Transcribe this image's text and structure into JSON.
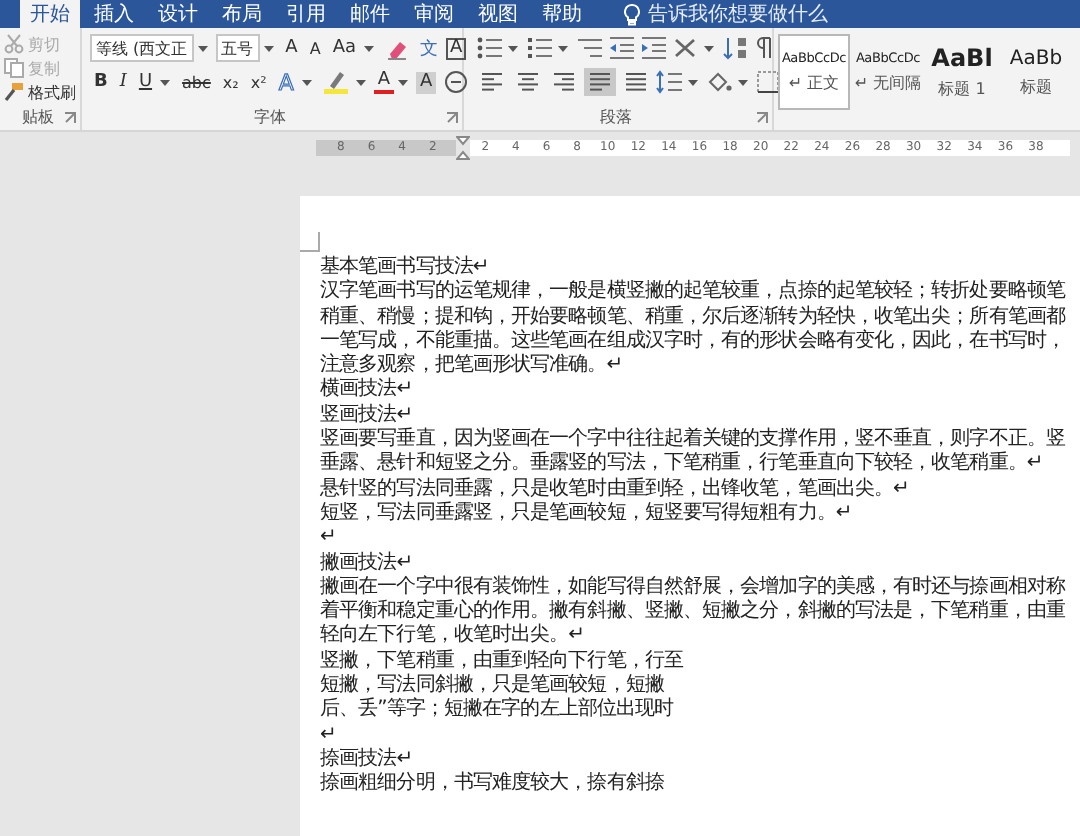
{
  "tabs": [
    {
      "label": "开始",
      "selected": true
    },
    {
      "label": "插入",
      "selected": false
    },
    {
      "label": "设计",
      "selected": false
    },
    {
      "label": "布局",
      "selected": false
    },
    {
      "label": "引用",
      "selected": false
    },
    {
      "label": "邮件",
      "selected": false
    },
    {
      "label": "审阅",
      "selected": false
    },
    {
      "label": "视图",
      "selected": false
    },
    {
      "label": "帮助",
      "selected": false
    }
  ],
  "tell_me": {
    "placeholder": "告诉我你想要做什么"
  },
  "clipboard": {
    "label": "贴板",
    "items": [
      {
        "kind": "cut",
        "text": "剪切",
        "disabled": true
      },
      {
        "kind": "copy",
        "text": "复制",
        "disabled": true
      },
      {
        "kind": "painter",
        "text": "格式刷",
        "disabled": false
      }
    ]
  },
  "font": {
    "label": "字体",
    "name": "等线 (西文正",
    "size": "五号",
    "row1": [
      {
        "kind": "grow",
        "text": "A"
      },
      {
        "kind": "shrink",
        "text": "A"
      },
      {
        "kind": "case",
        "text": "Aa"
      },
      {
        "kind": "clear"
      },
      {
        "kind": "phonetic",
        "text": "文"
      },
      {
        "kind": "border",
        "text": "A"
      }
    ],
    "row2": [
      {
        "kind": "bold",
        "text": "B"
      },
      {
        "kind": "italic",
        "text": "I"
      },
      {
        "kind": "underline",
        "text": "U"
      },
      {
        "kind": "strike",
        "text": "abc"
      },
      {
        "kind": "sub",
        "text": "x₂"
      },
      {
        "kind": "sup",
        "text": "x²"
      },
      {
        "kind": "effect",
        "text": "A"
      },
      {
        "kind": "highlight"
      },
      {
        "kind": "color",
        "text": "A"
      },
      {
        "kind": "shading",
        "text": "A"
      },
      {
        "kind": "enclose"
      }
    ]
  },
  "paragraph": {
    "label": "段落",
    "alignment": [
      {
        "kind": "left",
        "selected": false
      },
      {
        "kind": "center",
        "selected": false
      },
      {
        "kind": "right",
        "selected": false
      },
      {
        "kind": "justify",
        "selected": true
      },
      {
        "kind": "distributed",
        "selected": false
      }
    ]
  },
  "styles": [
    {
      "kind": "normal",
      "preview": "AaBbCcDc",
      "name": "↵ 正文",
      "selected": true
    },
    {
      "kind": "normal",
      "preview": "AaBbCcDc",
      "name": "↵ 无间隔",
      "selected": false
    },
    {
      "kind": "heading1",
      "preview": "AaBl",
      "name": "标题 1",
      "selected": false
    },
    {
      "kind": "heading2",
      "preview": "AaBb",
      "name": "标题",
      "selected": false
    }
  ],
  "ruler": {
    "left_marks": [
      "8",
      "6",
      "4",
      "2"
    ],
    "right_marks": [
      "2",
      "4",
      "6",
      "8",
      "10",
      "12",
      "14",
      "16",
      "18",
      "20",
      "22",
      "24",
      "26",
      "28",
      "30",
      "32",
      "34",
      "36",
      "38"
    ]
  },
  "document": {
    "lines": [
      "基本笔画书写技法↵",
      "汉字笔画书写的运笔规律，一般是横竖撇的起笔较重，点捺的起笔较轻；转折处要略顿笔",
      "稍重、稍慢；提和钩，开始要略顿笔、稍重，尔后逐渐转为轻快，收笔出尖；所有笔画都",
      "一笔写成，不能重描。这些笔画在组成汉字时，有的形状会略有变化，因此，在书写时，",
      "注意多观察，把笔画形状写准确。↵",
      "横画技法↵",
      "竖画技法↵",
      "竖画要写垂直，因为竖画在一个字中往往起着关键的支撑作用，竖不垂直，则字不正。竖",
      "垂露、悬针和短竖之分。垂露竖的写法，下笔稍重，行笔垂直向下较轻，收笔稍重。↵",
      "悬针竖的写法同垂露，只是收笔时由重到轻，出锋收笔，笔画出尖。↵",
      "短竖，写法同垂露竖，只是笔画较短，短竖要写得短粗有力。↵",
      "↵",
      "撇画技法↵",
      "撇画在一个字中很有装饰性，如能写得自然舒展，会增加字的美感，有时还与捺画相对称",
      "着平衡和稳定重心的作用。撇有斜撇、竖撇、短撇之分，斜撇的写法是，下笔稍重，由重",
      "轻向左下行笔，收笔时出尖。↵",
      "竖撇，下笔稍重，由重到轻向下行笔，行至",
      "短撇，写法同斜撇，只是笔画较短，短撇",
      "后、丢”等字；短撇在字的左上部位出现时",
      "↵",
      "捺画技法↵",
      "捺画粗细分明，书写难度较大，捺有斜捺"
    ]
  }
}
